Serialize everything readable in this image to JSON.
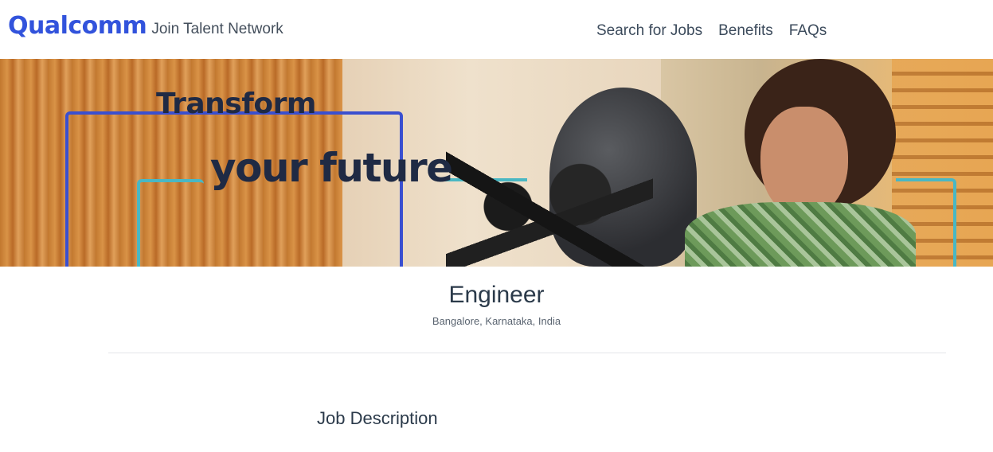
{
  "header": {
    "logo_text": "Qualcomm",
    "logo_subtitle": "Join Talent Network",
    "nav": [
      {
        "label": "Search for Jobs"
      },
      {
        "label": "Benefits"
      },
      {
        "label": "FAQs"
      }
    ]
  },
  "hero": {
    "line1": "Transform",
    "line2": "your future",
    "accent_blue": "#3a4fd0",
    "accent_teal": "#4ab7c3"
  },
  "job": {
    "title": "Engineer",
    "location": "Bangalore, Karnataka, India"
  },
  "sections": {
    "description_heading": "Job Description"
  }
}
